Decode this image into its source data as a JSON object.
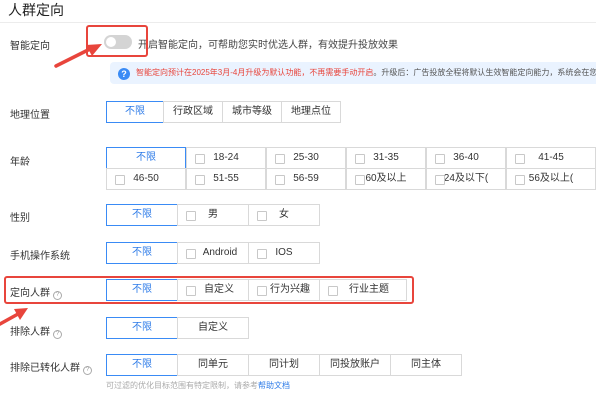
{
  "section_title": "人群定向",
  "smart": {
    "label": "智能定向",
    "description": "开启智能定向，可帮助您实时优选人群，有效提升投放效果"
  },
  "notice": {
    "red_text": "智能定向预计在2025年3月-4月升级为默认功能，不再需要手动开启",
    "gray_text": "。升级后：广告投放全程将默认生效智能定向能力，系统会在您"
  },
  "geo": {
    "label": "地理位置",
    "options": [
      "不限",
      "行政区域",
      "城市等级",
      "地理点位"
    ]
  },
  "age": {
    "label": "年龄",
    "row1": [
      "不限",
      "18-24",
      "25-30",
      "31-35",
      "36-40",
      "41-45"
    ],
    "row2": [
      "46-50",
      "51-55",
      "56-59",
      "60及以上",
      "24及以下(",
      "56及以上("
    ]
  },
  "gender": {
    "label": "性别",
    "options": [
      "不限",
      "男",
      "女"
    ]
  },
  "os": {
    "label": "手机操作系统",
    "options": [
      "不限",
      "Android",
      "IOS"
    ]
  },
  "target": {
    "label": "定向人群",
    "options": [
      "不限",
      "自定义",
      "行为兴趣",
      "行业主题"
    ]
  },
  "exclude": {
    "label": "排除人群",
    "options": [
      "不限",
      "自定义"
    ]
  },
  "converted": {
    "label": "排除已转化人群",
    "options": [
      "不限",
      "同单元",
      "同计划",
      "同投放账户",
      "同主体"
    ]
  },
  "footer": {
    "text": "可过滤的优化目标范围有特定限制，请参考",
    "link": "帮助文档"
  },
  "colors": {
    "accent": "#2f7ce8",
    "highlight": "#e8453c",
    "notice_bg": "#eaf3ff"
  }
}
